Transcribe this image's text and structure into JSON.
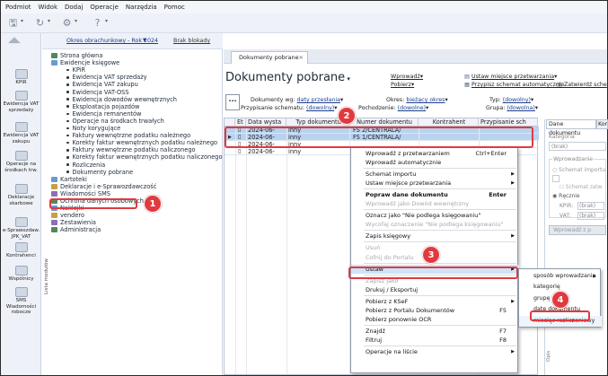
{
  "menubar": [
    "Podmiot",
    "Widok",
    "Dodaj",
    "Operacje",
    "Narzędzia",
    "Pomoc"
  ],
  "tree": {
    "period": "Okres obrachunkowy - Rok 2024",
    "no_lock": "Brak blokady",
    "items": [
      {
        "label": "Strona główna",
        "level": 0
      },
      {
        "label": "Ewidencje księgowe",
        "level": 0
      },
      {
        "label": "KPiR",
        "level": 1
      },
      {
        "label": "Ewidencja VAT sprzedaży",
        "level": 1
      },
      {
        "label": "Ewidencja VAT zakupu",
        "level": 1
      },
      {
        "label": "Ewidencja VAT-OSS",
        "level": 1
      },
      {
        "label": "Ewidencja dowodów wewnętrznych",
        "level": 1
      },
      {
        "label": "Eksploatacja pojazdów",
        "level": 1
      },
      {
        "label": "Ewidencja remanentów",
        "level": 1
      },
      {
        "label": "Operacje na środkach trwałych",
        "level": 1
      },
      {
        "label": "Noty korygujące",
        "level": 1
      },
      {
        "label": "Faktury wewnętrzne podatku należnego",
        "level": 1
      },
      {
        "label": "Korekty faktur wewnętrznych podatku należnego",
        "level": 1
      },
      {
        "label": "Faktury wewnętrzne podatku naliczonego",
        "level": 1
      },
      {
        "label": "Korekty faktur wewnętrznych podatku naliczonego",
        "level": 1
      },
      {
        "label": "Rozliczenia",
        "level": 1
      },
      {
        "label": "Dokumenty pobrane",
        "level": 1
      },
      {
        "label": "Kartoteki",
        "level": 0
      },
      {
        "label": "Deklaracje i e-Sprawozdawczość",
        "level": 0
      },
      {
        "label": "Wiadomości SMS",
        "level": 0
      },
      {
        "label": "Ochrona danych osobowych",
        "level": 0
      },
      {
        "label": "Naklejki",
        "level": 0
      },
      {
        "label": "vendero",
        "level": 0
      },
      {
        "label": "Zestawienia",
        "level": 0
      },
      {
        "label": "Administracja",
        "level": 0
      }
    ],
    "vertical_tab": "Lista modułów"
  },
  "leftbar": [
    {
      "label": "KPiR"
    },
    {
      "label": "Ewidencja VAT sprzedaży"
    },
    {
      "label": "Ewidencja VAT zakupu"
    },
    {
      "label": "Operacje na środkach trw."
    },
    {
      "label": "Deklaracje skarbowe"
    },
    {
      "label": "e-Sprawozdaw. JPK_VAT"
    },
    {
      "label": "Kontrahenci"
    },
    {
      "label": "Wspólnicy"
    },
    {
      "label": "SMS Wiadomości robocze"
    }
  ],
  "main": {
    "tab": "Dokumenty pobrane",
    "title": "Dokumenty pobrane",
    "wprowadz": "Wprowadź",
    "pobierz": "Pobierz",
    "ustaw_miejsce": "Ustaw miejsce przetwarzania",
    "przypisz_schemat_auto": "Przypisz schemat automatycznie",
    "zatwierdz": "Zatwierdź sche",
    "dokumenty_wg_label": "Dokumenty wg:",
    "dokumenty_wg_value": "daty przesłania",
    "przypisanie_label": "Przypisanie schematu:",
    "przypisanie_value": "(dowolny)",
    "okres_label": "Okres:",
    "okres_value": "bieżący okres",
    "pochodzenie_label": "Pochodzenie:",
    "pochodzenie_value": "(dowolne)",
    "typ_label": "Typ:",
    "typ_value": "(dowolny)",
    "grupa_label": "Grupa:",
    "grupa_value": "(dowolna)"
  },
  "grid": {
    "headers": [
      "Et",
      "Data wysta",
      "Typ dokumentu",
      "Numer dokumentu",
      "Kontrahent",
      "Przypisanie sch"
    ],
    "rows": [
      {
        "date": "2024-06-",
        "type": "inny",
        "number": "FS 2/CENTRALA/",
        "contractor": "",
        "scheme": "",
        "selected": true
      },
      {
        "date": "2024-06-",
        "type": "inny",
        "number": "FS 1/CENTRALA/",
        "contractor": "",
        "scheme": "",
        "selected": true
      },
      {
        "date": "2024-06-",
        "type": "inny",
        "number": "",
        "contractor": "",
        "scheme": "",
        "selected": false
      },
      {
        "date": "2024-06-",
        "type": "inny",
        "number": "",
        "contractor": "",
        "scheme": "",
        "selected": false
      }
    ]
  },
  "right_panel": {
    "tab1": "Dane dokumentu",
    "tab2": "Kom",
    "kategoria_label": "Kategoria",
    "kategoria_value": "(brak)",
    "wprowadzanie_label": "Wprowadzanie",
    "schemat_label": "Schemat importu",
    "schemat_zatw_label": "Schemat zatw.",
    "recznie_label": "Ręcznie",
    "kpir_label": "KPiR:",
    "kpir_value": "(brak)",
    "vat_label": "VAT:",
    "vat_value": "(brak)",
    "wprowadz_btn": "Wprowadź z p",
    "opis_label": "Opis"
  },
  "context_menu": [
    {
      "label": "Wprowadź z przetwarzaniem",
      "shortcut": "Ctrl+Enter",
      "disabled": false,
      "arrow": false,
      "bold": false
    },
    {
      "label": "Wprowadź automatycznie",
      "shortcut": "",
      "disabled": false,
      "arrow": false,
      "bold": false
    },
    {
      "sep": true
    },
    {
      "label": "Schemat importu",
      "shortcut": "",
      "disabled": false,
      "arrow": true,
      "bold": false
    },
    {
      "label": "Ustaw miejsce przetwarzania",
      "shortcut": "",
      "disabled": false,
      "arrow": true,
      "bold": false
    },
    {
      "sep": true
    },
    {
      "label": "Popraw dane dokumentu",
      "shortcut": "Enter",
      "disabled": false,
      "arrow": false,
      "bold": true
    },
    {
      "label": "Wprowadź jako Dowód wewnętrzny",
      "shortcut": "",
      "disabled": true,
      "arrow": false,
      "bold": false
    },
    {
      "sep": true
    },
    {
      "label": "Oznacz jako \"Nie podlega księgowaniu\"",
      "shortcut": "",
      "disabled": false,
      "arrow": false,
      "bold": false
    },
    {
      "label": "Wycofaj oznaczenie \"Nie podlega księgowaniu\"",
      "shortcut": "",
      "disabled": true,
      "arrow": false,
      "bold": false
    },
    {
      "sep": true
    },
    {
      "label": "Zapis księgowy",
      "shortcut": "",
      "disabled": false,
      "arrow": true,
      "bold": false
    },
    {
      "sep": true
    },
    {
      "label": "Usuń",
      "shortcut": "",
      "disabled": true,
      "arrow": false,
      "bold": false
    },
    {
      "label": "Cofnij do Portalu",
      "shortcut": "",
      "disabled": true,
      "arrow": false,
      "bold": false
    },
    {
      "sep": true
    },
    {
      "label": "Ustaw",
      "shortcut": "",
      "disabled": false,
      "arrow": true,
      "bold": false,
      "highlight": true
    },
    {
      "sep": true
    },
    {
      "label": "Zapisz jako",
      "shortcut": "",
      "disabled": true,
      "arrow": false,
      "bold": false
    },
    {
      "label": "Drukuj / Eksportuj",
      "shortcut": "",
      "disabled": false,
      "arrow": false,
      "bold": false
    },
    {
      "sep": true
    },
    {
      "label": "Pobierz z KSeF",
      "shortcut": "",
      "disabled": false,
      "arrow": true,
      "bold": false
    },
    {
      "label": "Pobierz z Portalu Dokumentów",
      "shortcut": "F5",
      "disabled": false,
      "arrow": false,
      "bold": false
    },
    {
      "label": "Pobierz ponownie OCR",
      "shortcut": "",
      "disabled": false,
      "arrow": false,
      "bold": false
    },
    {
      "sep": true
    },
    {
      "label": "Znajdź",
      "shortcut": "F7",
      "disabled": false,
      "arrow": false,
      "bold": false
    },
    {
      "label": "Filtruj",
      "shortcut": "F8",
      "disabled": false,
      "arrow": false,
      "bold": false
    },
    {
      "sep": true
    },
    {
      "label": "Operacje na liście",
      "shortcut": "",
      "disabled": false,
      "arrow": true,
      "bold": false
    }
  ],
  "submenu": [
    {
      "label": "sposób wprowadzania",
      "arrow": true
    },
    {
      "label": "kategorię",
      "arrow": false
    },
    {
      "label": "grupę",
      "arrow": false
    },
    {
      "label": "datę dokumentu",
      "arrow": false
    },
    {
      "label": "miesiąc rozliczeniowy",
      "arrow": false,
      "highlight": true
    }
  ],
  "callouts": [
    "1",
    "2",
    "3",
    "4"
  ],
  "colors": {
    "accent": "#e03a3f",
    "selection": "#b8d3f0",
    "link": "#1a3d8f"
  }
}
